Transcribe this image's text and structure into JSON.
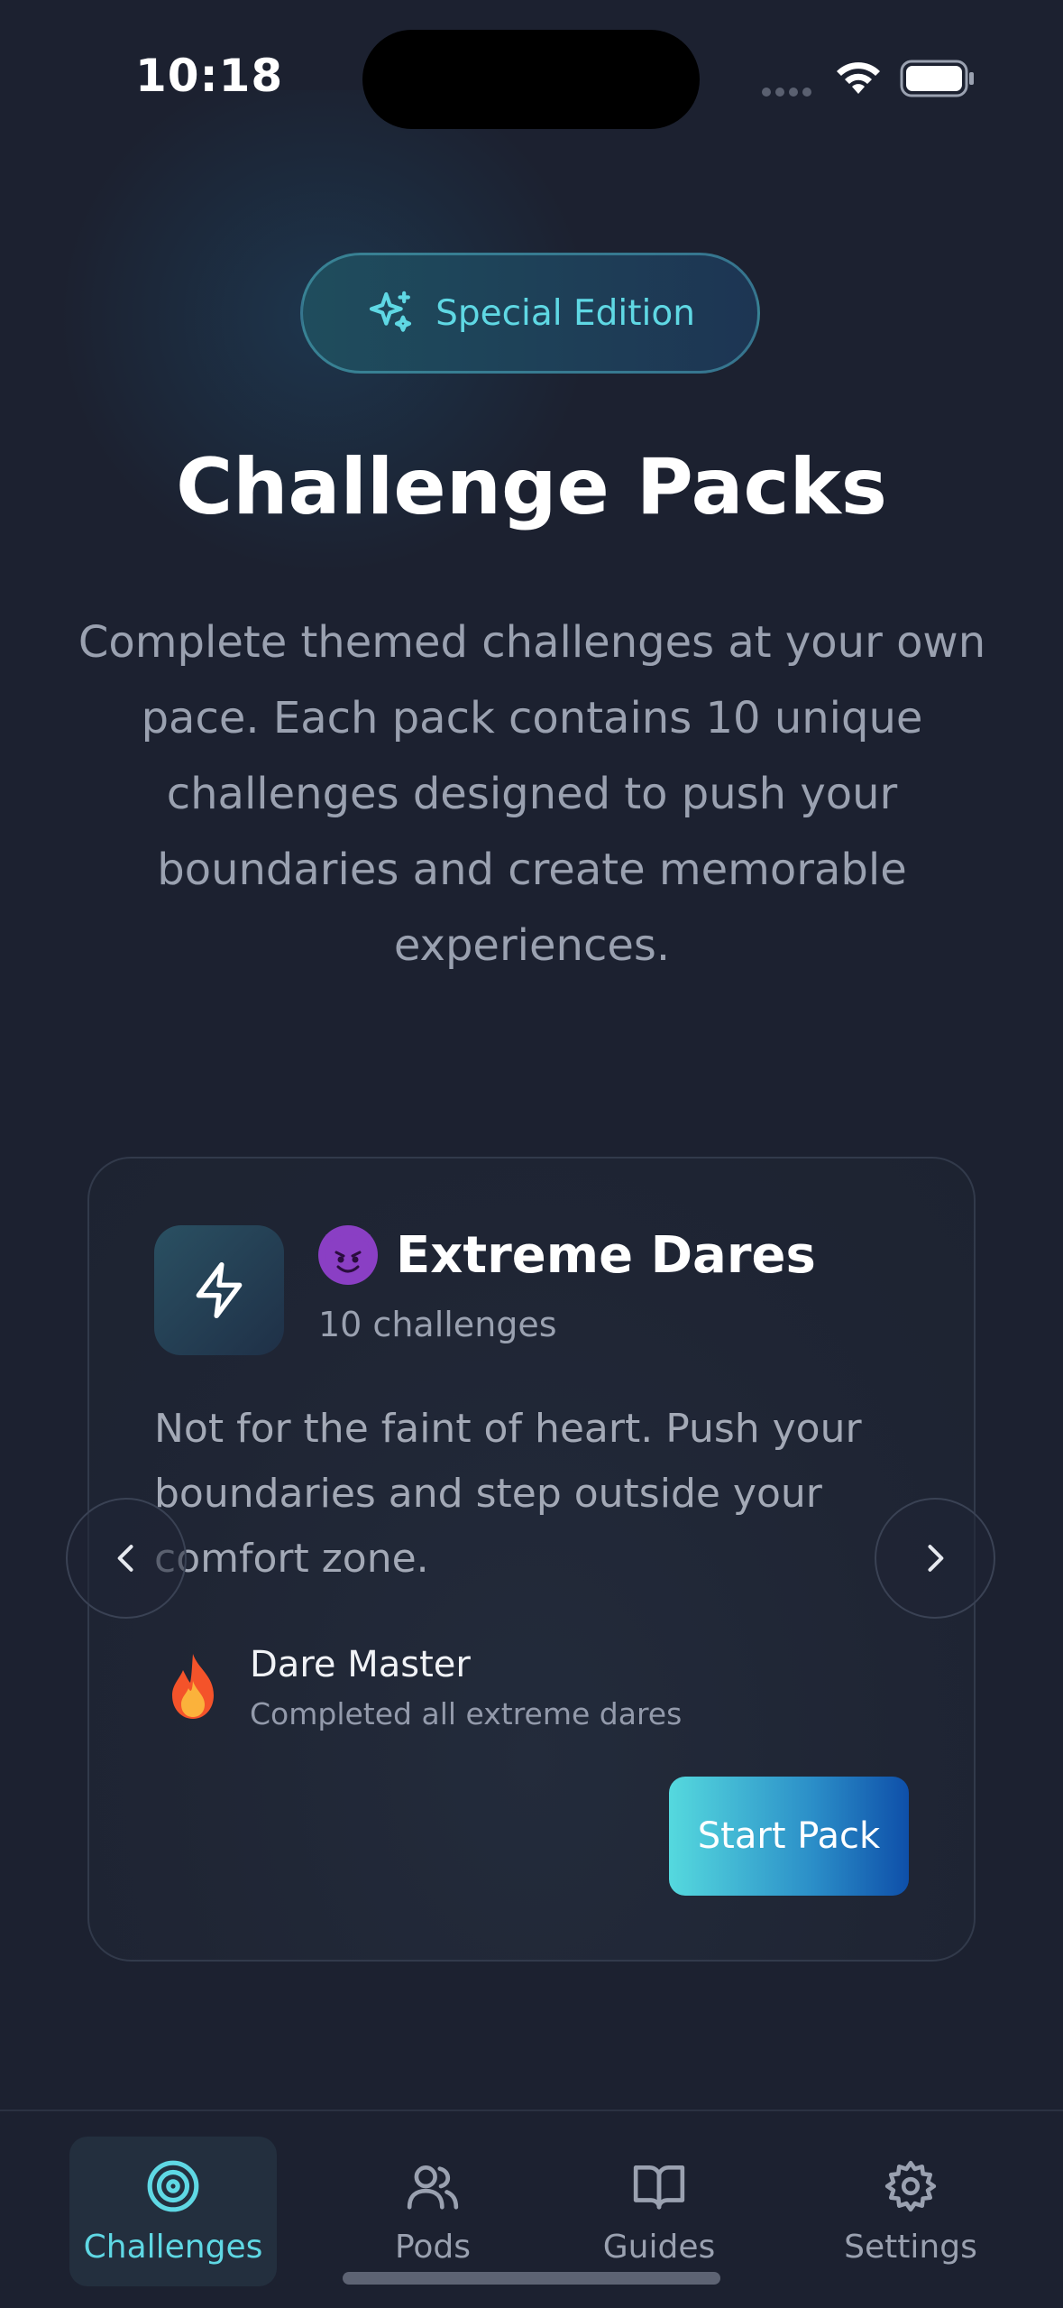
{
  "status_bar": {
    "time": "10:18"
  },
  "badge": {
    "label": "Special Edition",
    "icon": "sparkles-icon"
  },
  "header": {
    "title": "Challenge Packs",
    "description": "Complete themed challenges at your own pace. Each pack contains 10 unique challenges designed to push your boundaries and create memorable experiences."
  },
  "pack": {
    "icon": "lightning-icon",
    "emoji": "devil-emoji",
    "title": "Extreme Dares",
    "count": "10 challenges",
    "description": "Not for the faint of heart. Push your boundaries and step outside your comfort zone.",
    "reward": {
      "icon": "fire-icon",
      "title": "Dare Master",
      "subtitle": "Completed all extreme dares"
    },
    "start_label": "Start Pack"
  },
  "tabs": [
    {
      "label": "Challenges",
      "icon": "target-icon",
      "active": true
    },
    {
      "label": "Pods",
      "icon": "users-icon",
      "active": false
    },
    {
      "label": "Guides",
      "icon": "book-icon",
      "active": false
    },
    {
      "label": "Settings",
      "icon": "gear-icon",
      "active": false
    }
  ],
  "colors": {
    "background": "#1c2130",
    "accent": "#5fd8e4",
    "button_gradient_start": "#55d9de",
    "button_gradient_end": "#0e4fa9"
  }
}
